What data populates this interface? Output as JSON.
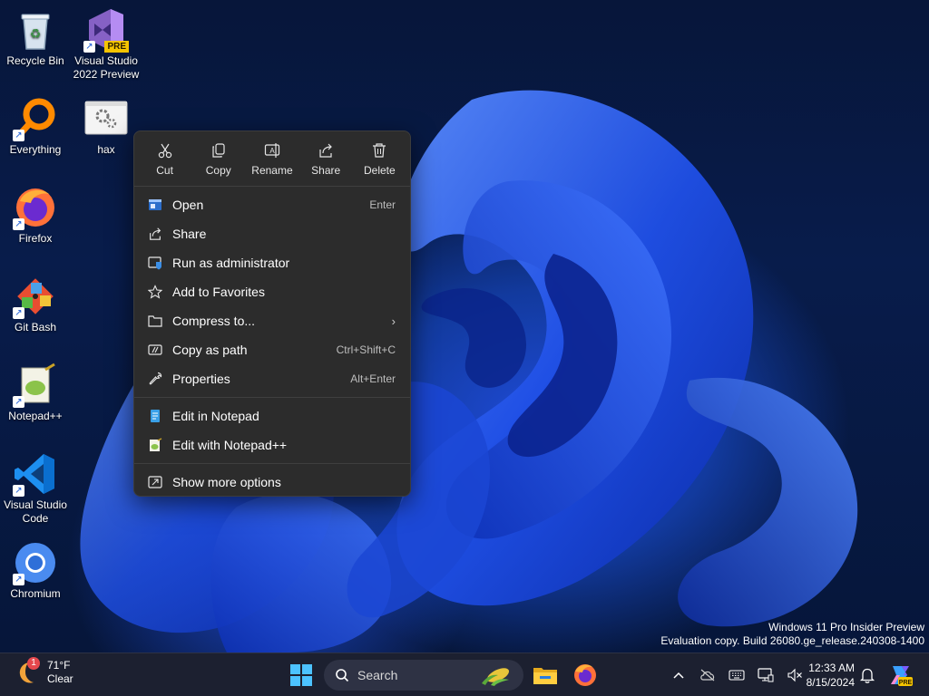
{
  "desktop": {
    "icons": [
      {
        "label": "Recycle Bin",
        "icon": "recycle-bin-icon"
      },
      {
        "label": "Visual Studio 2022 Preview",
        "icon": "visual-studio-icon",
        "badge": "PRE"
      },
      {
        "label": "Everything",
        "icon": "everything-search-icon"
      },
      {
        "label": "hax",
        "icon": "settings-file-icon"
      },
      {
        "label": "Firefox",
        "icon": "firefox-icon"
      },
      {
        "label": "Git Bash",
        "icon": "git-bash-icon"
      },
      {
        "label": "Notepad++",
        "icon": "notepadpp-icon"
      },
      {
        "label": "Visual Studio Code",
        "icon": "vscode-icon"
      },
      {
        "label": "Chromium",
        "icon": "chromium-icon"
      }
    ]
  },
  "context_menu": {
    "quick_actions": [
      {
        "label": "Cut",
        "icon": "cut-icon"
      },
      {
        "label": "Copy",
        "icon": "copy-icon"
      },
      {
        "label": "Rename",
        "icon": "rename-icon"
      },
      {
        "label": "Share",
        "icon": "share-icon"
      },
      {
        "label": "Delete",
        "icon": "delete-icon"
      }
    ],
    "items": [
      {
        "label": "Open",
        "shortcut": "Enter",
        "icon": "open-icon"
      },
      {
        "label": "Share",
        "shortcut": "",
        "icon": "share-icon"
      },
      {
        "label": "Run as administrator",
        "shortcut": "",
        "icon": "admin-shield-icon"
      },
      {
        "label": "Add to Favorites",
        "shortcut": "",
        "icon": "star-icon"
      },
      {
        "label": "Compress to...",
        "shortcut": "",
        "icon": "archive-icon",
        "submenu": true
      },
      {
        "label": "Copy as path",
        "shortcut": "Ctrl+Shift+C",
        "icon": "copy-path-icon"
      },
      {
        "label": "Properties",
        "shortcut": "Alt+Enter",
        "icon": "wrench-icon"
      },
      {
        "label": "Edit in Notepad",
        "shortcut": "",
        "icon": "notepad-icon"
      },
      {
        "label": "Edit with Notepad++",
        "shortcut": "",
        "icon": "notepadpp-icon"
      },
      {
        "label": "Show more options",
        "shortcut": "",
        "icon": "more-options-icon"
      }
    ],
    "submenu_arrow": "›"
  },
  "watermark": {
    "line1": "Windows 11 Pro Insider Preview",
    "line2": "Evaluation copy. Build 26080.ge_release.240308-1400"
  },
  "taskbar": {
    "weather": {
      "temp": "71°F",
      "condition": "Clear",
      "badge": "1"
    },
    "search_label": "Search",
    "apps": [
      "start-icon",
      "file-explorer-icon",
      "firefox-icon"
    ],
    "tray": [
      "chevron-up-icon",
      "cloud-offline-icon",
      "keyboard-icon",
      "display-icon",
      "volume-muted-icon"
    ],
    "time": "12:33 AM",
    "date": "8/15/2024"
  },
  "colors": {
    "menu_bg": "#2c2c2c",
    "taskbar_bg": "#1c2030",
    "accent": "#1f4bd8"
  }
}
